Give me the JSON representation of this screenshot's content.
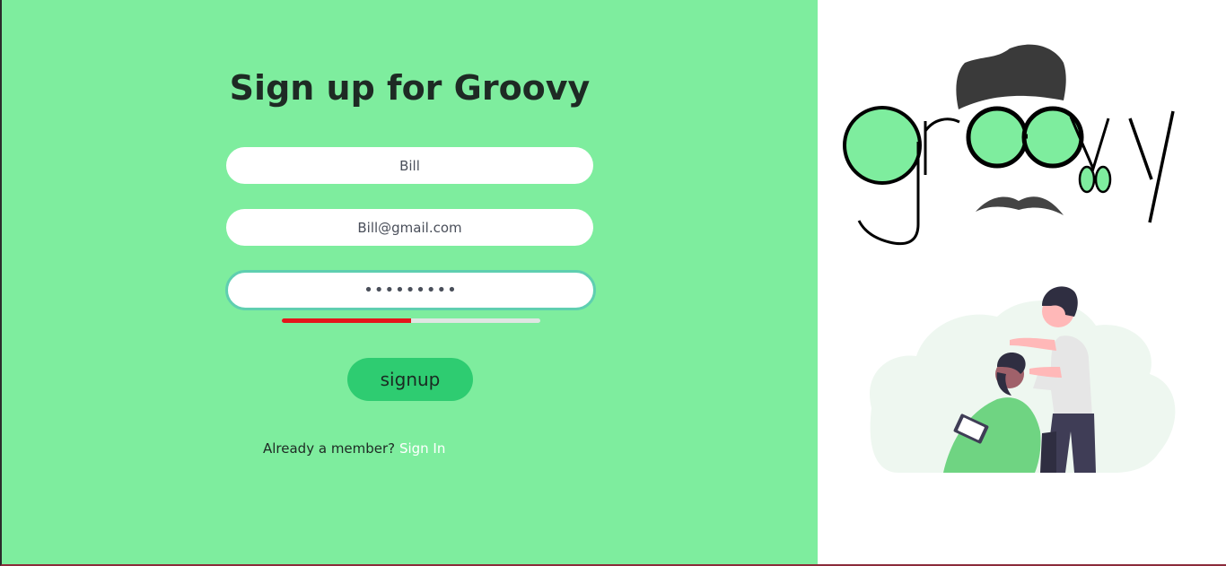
{
  "form": {
    "title": "Sign up for Groovy",
    "name_value": "Bill",
    "email_value": "Bill@gmail.com",
    "password_value": "•••••••••",
    "password_strength": 0.5,
    "signup_label": "signup",
    "member_text": "Already a member?",
    "signin_label": "Sign In"
  },
  "colors": {
    "left_bg": "#7eed9e",
    "button": "#2ecc71",
    "strength_weak": "#e3171b",
    "focus_border": "#5fcfb0",
    "link": "#ffffff"
  },
  "brand": {
    "logo_icon": "groovy-logo",
    "illustration_icon": "barber-illustration"
  }
}
